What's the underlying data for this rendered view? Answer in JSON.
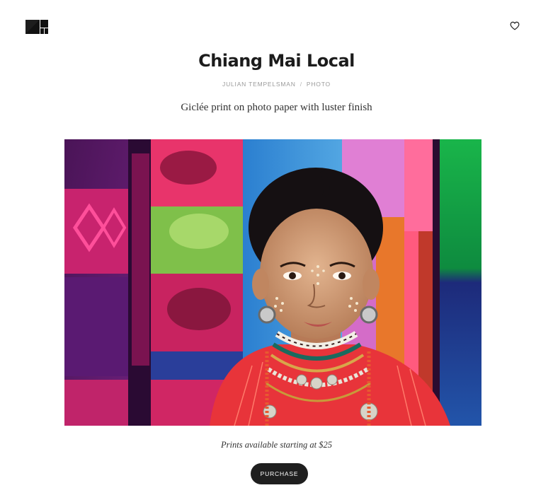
{
  "header": {
    "logo_icon": "squares-logo-icon",
    "favorite_icon": "heart-icon"
  },
  "product": {
    "title": "Chiang Mai Local",
    "author": "JULIAN TEMPELSMAN",
    "separator": "/",
    "category": "PHOTO",
    "description": "Giclée print on photo paper with luster finish",
    "image_alt": "Chiang Mai Local",
    "prints_note": "Prints available starting at $25",
    "purchase_label": "PURCHASE"
  },
  "colors": {
    "button": "#1f1f1f",
    "text": "#222222",
    "muted": "#9a9a9a"
  }
}
